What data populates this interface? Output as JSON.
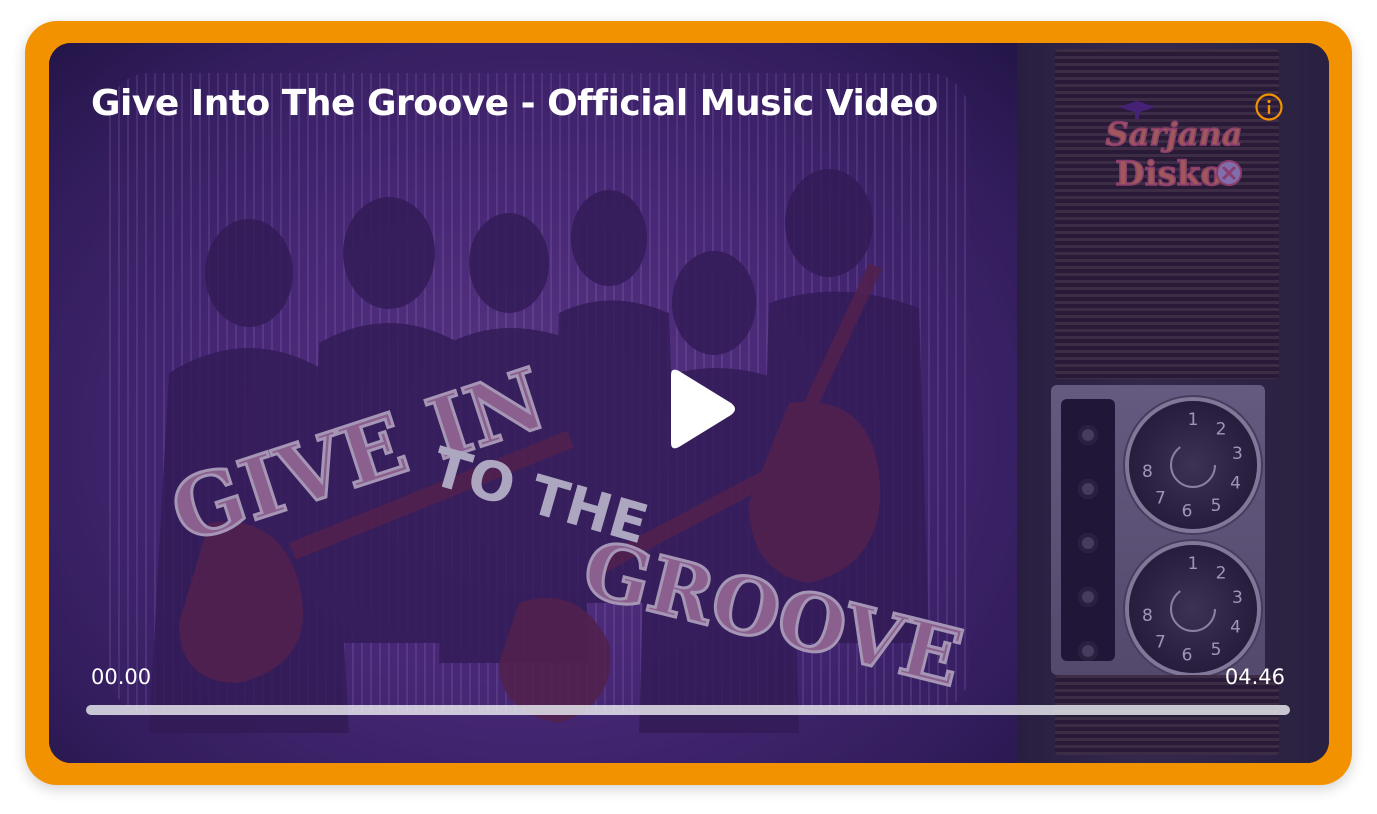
{
  "video": {
    "title": "Give Into The Groove - Official Music Video",
    "current_time": "00.00",
    "duration": "04.46",
    "progress_fraction": 0
  },
  "artwork": {
    "logo_text_line1": "Sarjana",
    "logo_text_line2": "Disko",
    "headline_line1": "GIVE IN",
    "headline_line2": "TO THE",
    "headline_line3": "GROOVE",
    "dial_numbers": [
      "1",
      "2",
      "3",
      "4",
      "5",
      "6",
      "7",
      "8"
    ]
  },
  "colors": {
    "frame": "#f39200",
    "accent_icon": "#f39200",
    "text": "#ffffff"
  },
  "icons": {
    "play": "play-icon",
    "info": "info-icon"
  }
}
